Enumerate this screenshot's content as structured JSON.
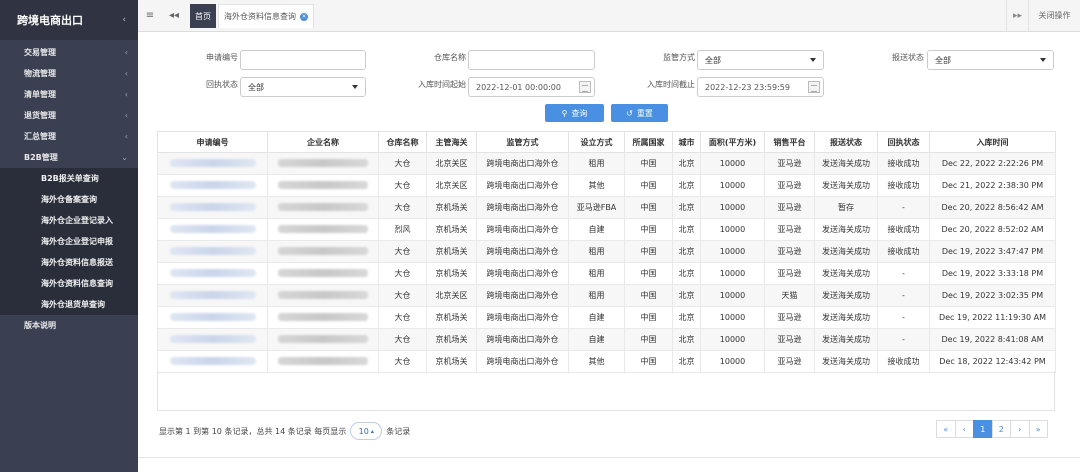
{
  "sidebar": {
    "title": "跨境电商出口",
    "items": [
      {
        "label": "交易管理",
        "arrow": "‹"
      },
      {
        "label": "物流管理",
        "arrow": "‹"
      },
      {
        "label": "清单管理",
        "arrow": "‹"
      },
      {
        "label": "退货管理",
        "arrow": "‹"
      },
      {
        "label": "汇总管理",
        "arrow": "‹"
      },
      {
        "label": "B2B管理",
        "arrow": "⌄"
      }
    ],
    "sub_items": [
      {
        "label": "B2B报关单查询"
      },
      {
        "label": "海外仓备案查询"
      },
      {
        "label": "海外仓企业登记录入"
      },
      {
        "label": "海外仓企业登记申报"
      },
      {
        "label": "海外仓资料信息报送"
      },
      {
        "label": "海外仓资料信息查询"
      },
      {
        "label": "海外仓退货单查询"
      }
    ],
    "last_item": "版本说明"
  },
  "topbar": {
    "menu_icon": "≡",
    "back_icon": "◂◂",
    "home_tab": "首页",
    "active_tab": "海外仓资料信息查询",
    "forward_icon": "▸▸",
    "close_ops": "关闭操作"
  },
  "filters": {
    "apply_no_label": "申请编号",
    "apply_no_value": "",
    "warehouse_label": "仓库名称",
    "warehouse_value": "",
    "supervise_label": "监管方式",
    "supervise_value": "全部",
    "report_status_label": "报送状态",
    "report_status_value": "全部",
    "receipt_status_label": "回执状态",
    "receipt_status_value": "全部",
    "in_start_label": "入库时间起始",
    "in_start_value": "2022-12-01 00:00:00",
    "in_end_label": "入库时间截止",
    "in_end_value": "2022-12-23 23:59:59",
    "search_btn": "查询",
    "reset_btn": "重置"
  },
  "table": {
    "columns": [
      "申请编号",
      "企业名称",
      "仓库名称",
      "主管海关",
      "监管方式",
      "设立方式",
      "所属国家",
      "城市",
      "面积(平方米)",
      "销售平台",
      "报送状态",
      "回执状态",
      "入库时间"
    ],
    "rows": [
      {
        "warehouse": "大仓",
        "customs": "北京关区",
        "mode": "跨境电商出口海外仓",
        "setup": "租用",
        "country": "中国",
        "city": "北京",
        "area": "10000",
        "platform": "亚马逊",
        "report": "发送海关成功",
        "receipt": "接收成功",
        "time": "Dec 22, 2022 2:22:26 PM"
      },
      {
        "warehouse": "大仓",
        "customs": "北京关区",
        "mode": "跨境电商出口海外仓",
        "setup": "其他",
        "country": "中国",
        "city": "北京",
        "area": "10000",
        "platform": "亚马逊",
        "report": "发送海关成功",
        "receipt": "接收成功",
        "time": "Dec 21, 2022 2:38:30 PM"
      },
      {
        "warehouse": "大仓",
        "customs": "京机场关",
        "mode": "跨境电商出口海外仓",
        "setup": "亚马逊FBA",
        "country": "中国",
        "city": "北京",
        "area": "10000",
        "platform": "亚马逊",
        "report": "暂存",
        "receipt": "-",
        "time": "Dec 20, 2022 8:56:42 AM"
      },
      {
        "warehouse": "烈风",
        "customs": "京机场关",
        "mode": "跨境电商出口海外仓",
        "setup": "自建",
        "country": "中国",
        "city": "北京",
        "area": "10000",
        "platform": "亚马逊",
        "report": "发送海关成功",
        "receipt": "接收成功",
        "time": "Dec 20, 2022 8:52:02 AM"
      },
      {
        "warehouse": "大仓",
        "customs": "京机场关",
        "mode": "跨境电商出口海外仓",
        "setup": "租用",
        "country": "中国",
        "city": "北京",
        "area": "10000",
        "platform": "亚马逊",
        "report": "发送海关成功",
        "receipt": "接收成功",
        "time": "Dec 19, 2022 3:47:47 PM"
      },
      {
        "warehouse": "大仓",
        "customs": "京机场关",
        "mode": "跨境电商出口海外仓",
        "setup": "租用",
        "country": "中国",
        "city": "北京",
        "area": "10000",
        "platform": "亚马逊",
        "report": "发送海关成功",
        "receipt": "-",
        "time": "Dec 19, 2022 3:33:18 PM"
      },
      {
        "warehouse": "大仓",
        "customs": "北京关区",
        "mode": "跨境电商出口海外仓",
        "setup": "租用",
        "country": "中国",
        "city": "北京",
        "area": "10000",
        "platform": "天猫",
        "report": "发送海关成功",
        "receipt": "-",
        "time": "Dec 19, 2022 3:02:35 PM"
      },
      {
        "warehouse": "大仓",
        "customs": "京机场关",
        "mode": "跨境电商出口海外仓",
        "setup": "自建",
        "country": "中国",
        "city": "北京",
        "area": "10000",
        "platform": "亚马逊",
        "report": "发送海关成功",
        "receipt": "-",
        "time": "Dec 19, 2022 11:19:30 AM"
      },
      {
        "warehouse": "大仓",
        "customs": "京机场关",
        "mode": "跨境电商出口海外仓",
        "setup": "自建",
        "country": "中国",
        "city": "北京",
        "area": "10000",
        "platform": "亚马逊",
        "report": "发送海关成功",
        "receipt": "-",
        "time": "Dec 19, 2022 8:41:08 AM"
      },
      {
        "warehouse": "大仓",
        "customs": "京机场关",
        "mode": "跨境电商出口海外仓",
        "setup": "其他",
        "country": "中国",
        "city": "北京",
        "area": "10000",
        "platform": "亚马逊",
        "report": "发送海关成功",
        "receipt": "接收成功",
        "time": "Dec 18, 2022 12:43:42 PM"
      }
    ]
  },
  "footer": {
    "info_prefix": "显示第 1 到第 10 条记录，总共 14 条记录 每页显示",
    "page_size": "10",
    "info_suffix": "条记录",
    "pager": [
      "«",
      "‹",
      "1",
      "2",
      "›",
      "»"
    ],
    "active_page": "1"
  }
}
